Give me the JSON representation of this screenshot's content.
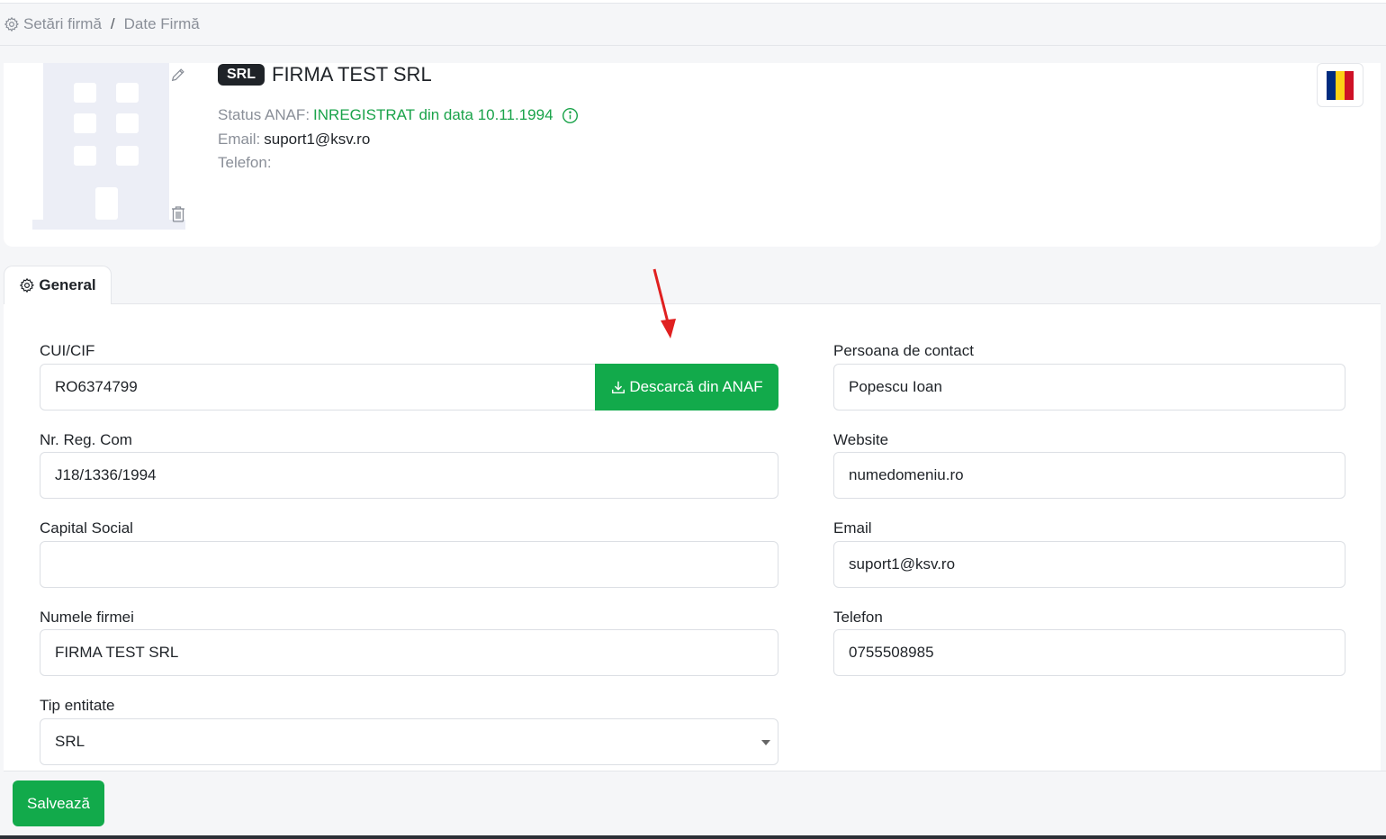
{
  "breadcrumb": {
    "item1": "Setări firmă",
    "separator": "/",
    "item2": "Date Firmă"
  },
  "company": {
    "type_badge": "SRL",
    "name": "FIRMA TEST SRL",
    "status_label": "Status ANAF:",
    "status_value": "INREGISTRAT din data 10.11.1994",
    "email_label": "Email:",
    "email_value": "suport1@ksv.ro",
    "phone_label": "Telefon:",
    "phone_value": ""
  },
  "tabs": [
    {
      "label": "General",
      "icon": "gear-icon"
    }
  ],
  "form": {
    "cui_label": "CUI/CIF",
    "cui_value": "RO6374799",
    "anaf_button": "Descarcă din ANAF",
    "reg_label": "Nr. Reg. Com",
    "reg_value": "J18/1336/1994",
    "capital_label": "Capital Social",
    "capital_value": "",
    "name_label": "Numele firmei",
    "name_value": "FIRMA TEST SRL",
    "entity_label": "Tip entitate",
    "entity_value": "SRL",
    "contact_label": "Persoana de contact",
    "contact_value": "Popescu Ioan",
    "website_label": "Website",
    "website_value": "numedomeniu.ro",
    "email_label": "Email",
    "email_value": "suport1@ksv.ro",
    "phone_label": "Telefon",
    "phone_value": "0755508985"
  },
  "footer": {
    "save_button": "Salvează"
  },
  "colors": {
    "accent_green": "#12aa4b",
    "status_green": "#1aa34a",
    "badge_dark": "#1f2328",
    "annotation_arrow": "#e02020"
  },
  "flag": {
    "name": "romania-flag-icon",
    "colors": [
      "#002b7f",
      "#fcd116",
      "#ce1126"
    ]
  }
}
